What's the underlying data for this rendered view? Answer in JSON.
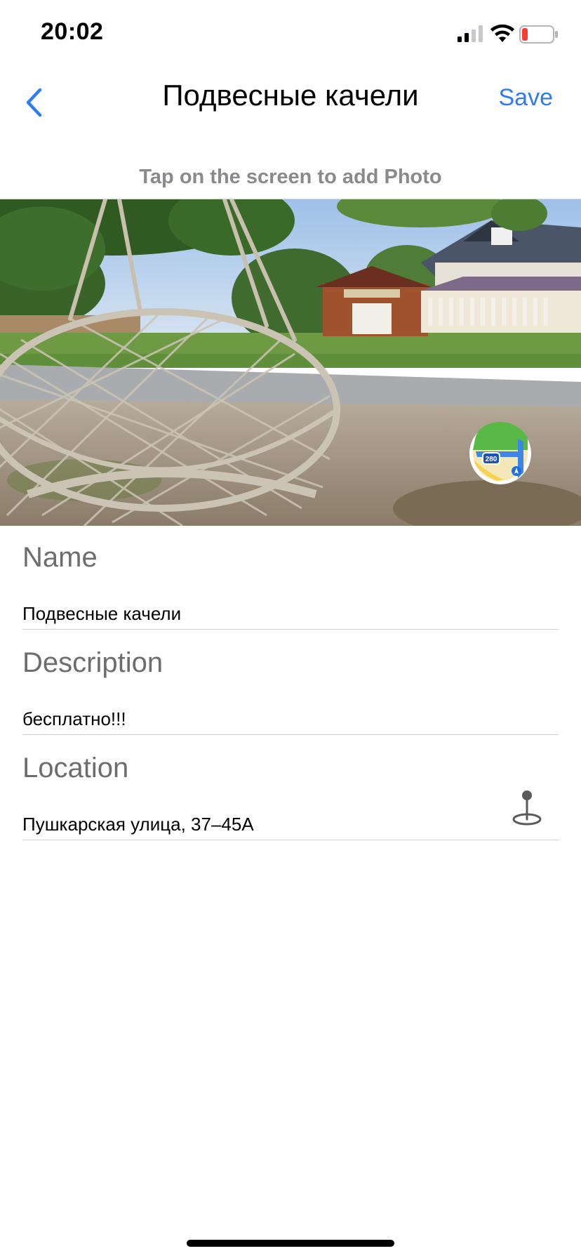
{
  "status_bar": {
    "time": "20:02",
    "signal_icon": "cellular-signal-icon",
    "wifi_icon": "wifi-icon",
    "battery_icon": "battery-low-icon"
  },
  "nav": {
    "back_icon": "chevron-left-icon",
    "title": "Подвесные качели",
    "save_label": "Save"
  },
  "photo": {
    "hint": "Tap on the screen to add Photo",
    "maps_icon": "apple-maps-icon",
    "maps_badge": "280"
  },
  "form": {
    "name": {
      "label": "Name",
      "value": "Подвесные качели"
    },
    "description": {
      "label": "Description",
      "value": "бесплатно!!!"
    },
    "location": {
      "label": "Location",
      "value": "Пушкарская улица, 37–45А",
      "pin_icon": "map-pin-icon"
    }
  },
  "colors": {
    "accent": "#2f7bf0",
    "label_gray": "#6d6d70",
    "hint_gray": "#8a8a8e",
    "divider": "#cfcfd2"
  }
}
